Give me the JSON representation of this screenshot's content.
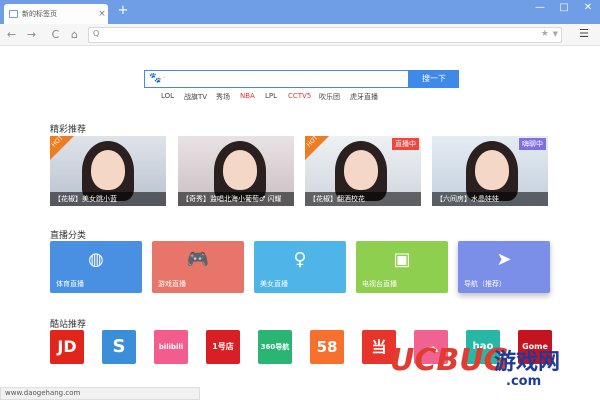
{
  "browser": {
    "tab_title": "新的标签页",
    "tab_close": "×",
    "new_tab": "+",
    "window_controls": [
      "—",
      "□",
      "✕"
    ],
    "nav": {
      "back": "←",
      "forward": "→",
      "refresh": "C",
      "home": "⌂"
    },
    "address_search": "Q",
    "star": "★",
    "menu": "☰"
  },
  "search": {
    "button": "搜一下",
    "placeholder": "·"
  },
  "hot_words": [
    "LOL",
    "战旗TV",
    "秀场",
    "NBA",
    "LPL",
    "CCTV5",
    "吹乐团",
    "虎牙直播"
  ],
  "hot_words_highlight": [
    "NBA",
    "CCTV5"
  ],
  "sections": {
    "featured": "精彩推荐",
    "live": "直播分类",
    "sites": "酷站推荐"
  },
  "featured": [
    {
      "caption": "【花椒】美女跳小蓝",
      "badge": "HOT",
      "tag": ""
    },
    {
      "caption": "【奇秀】监唱北海小葡萄♂ 闪耀",
      "badge": "",
      "tag": ""
    },
    {
      "caption": "【花椒】翻酒校花",
      "badge": "HOT",
      "tag": "直播中"
    },
    {
      "caption": "【六间房】水晶娃娃",
      "badge": "",
      "tag": "嗨聊中"
    }
  ],
  "categories": [
    {
      "label": "体育直播",
      "icon": "basketball-icon",
      "color": "#4a90e2"
    },
    {
      "label": "游戏直播",
      "icon": "gamepad-icon",
      "color": "#e8756a"
    },
    {
      "label": "美女直播",
      "icon": "girl-icon",
      "color": "#4fb4e8"
    },
    {
      "label": "电视台直播",
      "icon": "tv-icon",
      "color": "#8fcf4f"
    },
    {
      "label": "导航（推荐）",
      "icon": "navigation-icon",
      "color": "#7b8fe8"
    }
  ],
  "sites": [
    {
      "text": "JD",
      "color": "#e1251b"
    },
    {
      "text": "S",
      "color": "#3b8fd9"
    },
    {
      "text": "bilibili",
      "color": "#f25d8e"
    },
    {
      "text": "1号店",
      "color": "#d81f26"
    },
    {
      "text": "360导航",
      "color": "#2bb573"
    },
    {
      "text": "58",
      "color": "#f7702d"
    },
    {
      "text": "当",
      "color": "#e8352c"
    },
    {
      "text": "☁",
      "color": "#f06292"
    },
    {
      "text": "hao",
      "color": "#26b8a5"
    },
    {
      "text": "Gome",
      "color": "#c5141f"
    }
  ],
  "status_url": "www.daogehang.com",
  "watermark": {
    "ucbug": "UCBUG",
    "cn": "游戏网",
    "com": ".com"
  }
}
